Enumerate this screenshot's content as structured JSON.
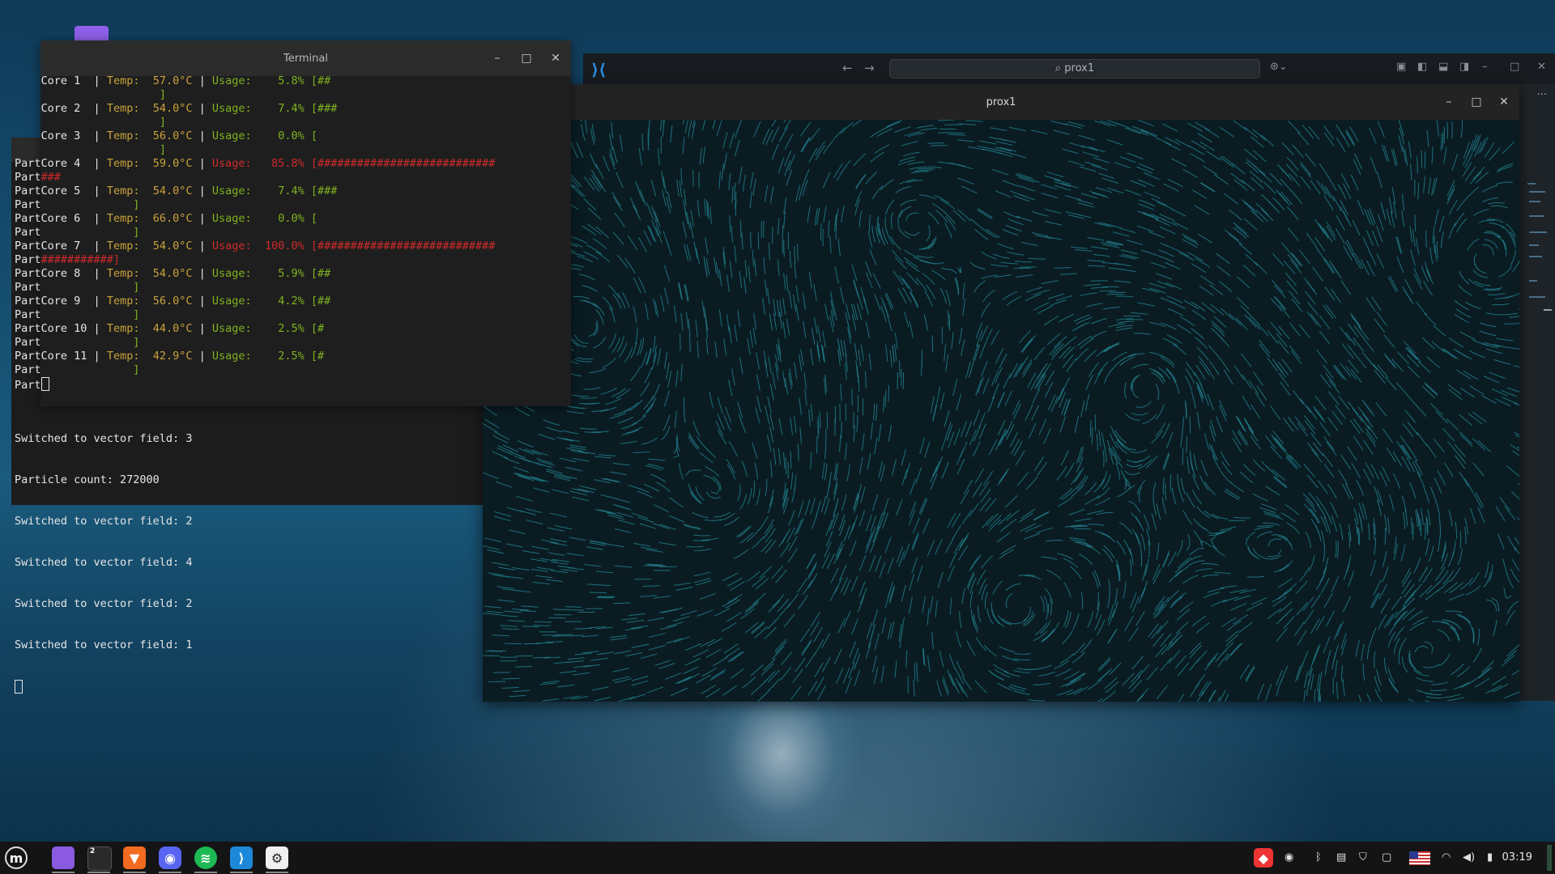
{
  "terminal": {
    "title": "Terminal",
    "core_lines": [
      {
        "label": "Core 1 ",
        "prefix": "",
        "temp": "57.0°C",
        "usage": "5.8%",
        "bar": "[##",
        "hot": false
      },
      {
        "label": "Core 2 ",
        "prefix": "",
        "temp": "54.0°C",
        "usage": "7.4%",
        "bar": "[###",
        "hot": false
      },
      {
        "label": "Core 3 ",
        "prefix": "",
        "temp": "56.0°C",
        "usage": "0.0%",
        "bar": "[",
        "hot": false
      },
      {
        "label": "Core 4 ",
        "prefix": "Part",
        "temp": "59.0°C",
        "usage": "85.8%",
        "bar": "[###########################",
        "hot": true
      },
      {
        "label": "Core 5 ",
        "prefix": "Part",
        "temp": "54.0°C",
        "usage": "7.4%",
        "bar": "[###",
        "hot": false
      },
      {
        "label": "Core 6 ",
        "prefix": "Part",
        "temp": "66.0°C",
        "usage": "0.0%",
        "bar": "[",
        "hot": false
      },
      {
        "label": "Core 7 ",
        "prefix": "Part",
        "temp": "54.0°C",
        "usage": "100.0%",
        "bar": "[###########################",
        "hot": true
      },
      {
        "label": "Core 8 ",
        "prefix": "Part",
        "temp": "54.0°C",
        "usage": "5.9%",
        "bar": "[##",
        "hot": false
      },
      {
        "label": "Core 9 ",
        "prefix": "Part",
        "temp": "56.0°C",
        "usage": "4.2%",
        "bar": "[##",
        "hot": false
      },
      {
        "label": "Core 10",
        "prefix": "Part",
        "temp": "44.0°C",
        "usage": "2.5%",
        "bar": "[#",
        "hot": false
      },
      {
        "label": "Core 11",
        "prefix": "Part",
        "temp": "42.9°C",
        "usage": "2.5%",
        "bar": "[#",
        "hot": false
      }
    ],
    "wrap_lines": [
      "]",
      "]",
      "]",
      "Part###",
      "Part",
      "Part",
      "Part###########]",
      "Part",
      "Part",
      "Part",
      "Part"
    ],
    "temp_label": "Temp:",
    "usage_label": "Usage:",
    "separator": "|",
    "bracket_close": "]",
    "part_prompt": "Part",
    "output_lines": [
      "Switched to vector field: 3",
      "Particle count: 272000",
      "Switched to vector field: 2",
      "Switched to vector field: 4",
      "Switched to vector field: 2",
      "Switched to vector field: 1"
    ]
  },
  "vscode": {
    "search_text": "prox1",
    "more": "···"
  },
  "prox": {
    "title": "prox1"
  },
  "taskbar": {
    "terminal_badge": "2",
    "clock": "03:19"
  },
  "colors": {
    "terminal_green": "#7fb21f",
    "terminal_yellow": "#c9a23a",
    "terminal_red": "#d12b2b",
    "particle_cyan": "#2fb3c4"
  }
}
